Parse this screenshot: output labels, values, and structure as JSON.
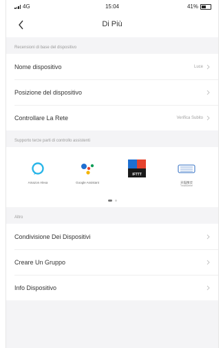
{
  "status_bar": {
    "carrier": "4G",
    "time": "15:04",
    "battery_text": "41%"
  },
  "nav": {
    "title": "Di Più"
  },
  "sections": {
    "device_info": {
      "header": "Recensioni di base del dispositivo",
      "rows": [
        {
          "label": "Nome dispositivo",
          "value": "Luce"
        },
        {
          "label": "Posizione del dispositivo",
          "value": ""
        },
        {
          "label": "Controllare La Rete",
          "value": "Verifica Subito"
        }
      ]
    },
    "assistants": {
      "header": "Supporto terze parti di controllo assistenti",
      "items": [
        {
          "name": "Alexa",
          "icon": "alexa-icon",
          "caption": "Amazon Alexa",
          "subcaption": ""
        },
        {
          "name": "Google Assistant",
          "icon": "google-assistant-icon",
          "caption": "Google Assistant",
          "subcaption": ""
        },
        {
          "name": "IFTTT",
          "icon": "ifttt-icon",
          "caption": "",
          "subcaption": ""
        },
        {
          "name": "Tmall Genie",
          "icon": "tmall-genie-icon",
          "caption": "天猫精灵",
          "subcaption": "TmallGenie"
        }
      ],
      "page_count": 2,
      "active_page": 1
    },
    "other": {
      "header": "Altro",
      "rows": [
        {
          "label": "Condivisione Dei Dispositivi"
        },
        {
          "label": "Creare Un Gruppo"
        },
        {
          "label": "Info Dispositivo"
        }
      ]
    }
  },
  "colors": {
    "alexa_blue": "#28b5e8",
    "ifttt_bg": "#1a1a1a",
    "ifttt_accent_red": "#e5432e",
    "ifttt_accent_blue": "#1e6fd1",
    "tmall_blue": "#5b8ccf"
  }
}
